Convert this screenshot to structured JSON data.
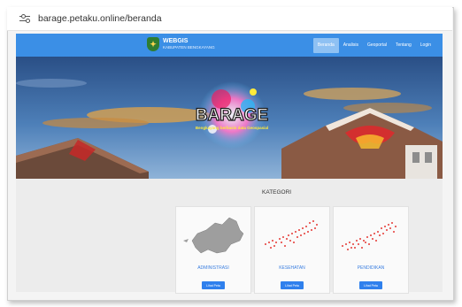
{
  "browser": {
    "url": "barage.petaku.online/beranda"
  },
  "navbar": {
    "brand_title": "WEBGIS",
    "brand_subtitle": "KABUPATEN BENGKAYANG",
    "items": [
      "Beranda",
      "Analisis",
      "Geoportal",
      "Tentang",
      "Login"
    ]
  },
  "hero": {
    "logo_text": "BARAGE",
    "tagline": "Bengkayang berbasis data Geospasial"
  },
  "section": {
    "title": "KATEGORI",
    "cards": [
      {
        "label": "ADMINISTRASI",
        "button": "Lihat Peta"
      },
      {
        "label": "KESEHATAN",
        "button": "Lihat Peta"
      },
      {
        "label": "PENDIDIKAN",
        "button": "Lihat Peta"
      }
    ]
  },
  "colors": {
    "navbar": "#3b8fe6",
    "button": "#2f80ed",
    "map_admin": "#999999",
    "map_points": "#e53935"
  }
}
